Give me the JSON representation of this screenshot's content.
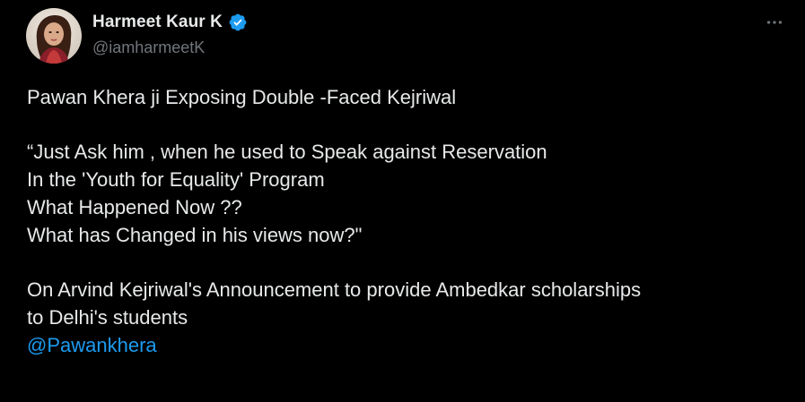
{
  "author": {
    "name": "Harmeet Kaur K",
    "handle": "@iamharmeetK",
    "verified_icon": "verified-badge-icon",
    "avatar_icon": "profile-avatar"
  },
  "menu": {
    "icon": "more-options-icon"
  },
  "tweet": {
    "line1": "Pawan Khera ji Exposing Double -Faced Kejriwal",
    "line2": "“Just Ask him , when he used to Speak against Reservation",
    "line3": "In the 'Youth for Equality' Program",
    "line4": "What Happened Now ??",
    "line5": "What has Changed in his views now?\"",
    "line6": "On Arvind Kejriwal's Announcement to provide Ambedkar scholarships",
    "line7": "to Delhi's students",
    "mention": "@Pawankhera"
  },
  "colors": {
    "background": "#000000",
    "text": "#e7e9ea",
    "secondary_text": "#71767b",
    "link": "#1d9bf0",
    "verified": "#1d9bf0"
  }
}
